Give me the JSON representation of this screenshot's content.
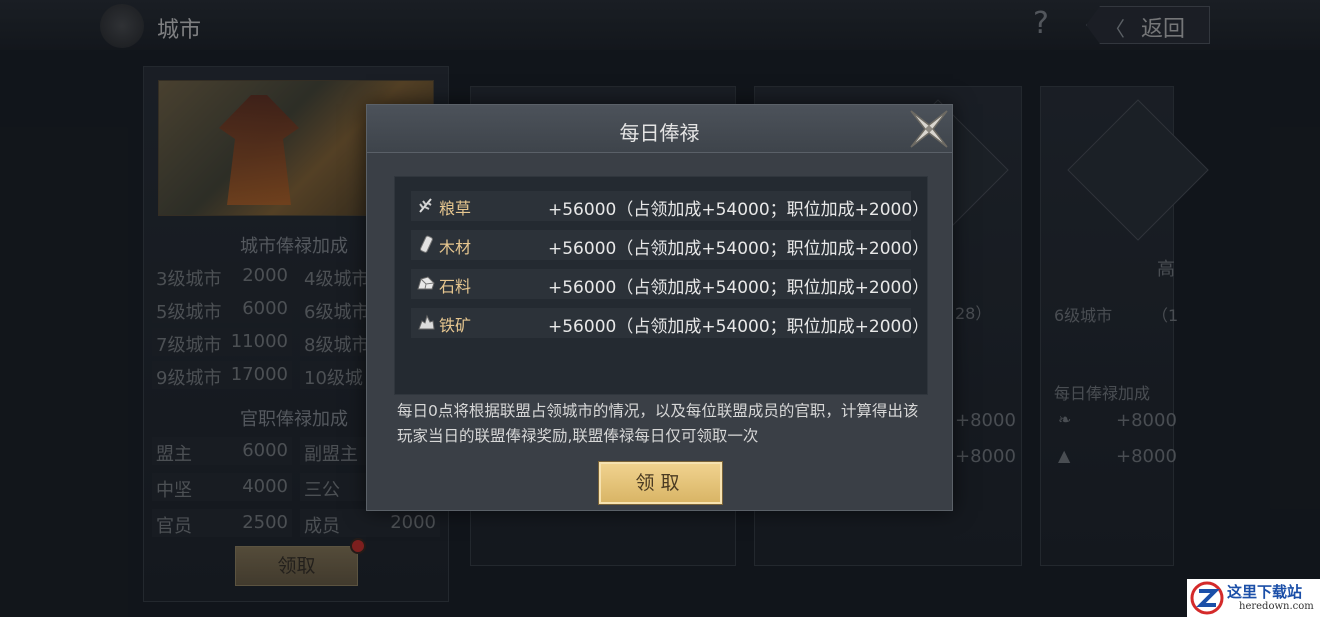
{
  "topbar": {
    "title": "城市",
    "help_label": "?",
    "back_label": "返回"
  },
  "bg_panel": {
    "salary_heading": "城市俸禄加成",
    "city_levels": [
      {
        "label": "3级城市",
        "value": "2000"
      },
      {
        "label": "4级城市",
        "value": ""
      },
      {
        "label": "5级城市",
        "value": "6000"
      },
      {
        "label": "6级城市",
        "value": ""
      },
      {
        "label": "7级城市",
        "value": "11000"
      },
      {
        "label": "8级城市",
        "value": ""
      },
      {
        "label": "9级城市",
        "value": "17000"
      },
      {
        "label": "10级城",
        "value": ""
      }
    ],
    "official_heading": "官职俸禄加成",
    "officials": [
      {
        "label": "盟主",
        "value": "6000"
      },
      {
        "label": "副盟主",
        "value": ""
      },
      {
        "label": "中坚",
        "value": "4000"
      },
      {
        "label": "三公",
        "value": ""
      },
      {
        "label": "官员",
        "value": "2500"
      },
      {
        "label": "成员",
        "value": "2000"
      }
    ],
    "claim_label": "领取"
  },
  "bg_right": {
    "p3_partial": "28）",
    "p3_plus1": "+8000",
    "p3_plus2": "+8000",
    "p4_title": "高",
    "p4_level": "6级城市",
    "p4_paren": "（1",
    "p4_heading": "每日俸禄加成",
    "p4_plus1": "+8000",
    "p4_plus2": "+8000"
  },
  "modal": {
    "title": "每日俸禄",
    "rows": [
      {
        "icon": "grain-icon",
        "label": "粮草",
        "value": "+56000（占领加成+54000；职位加成+2000）"
      },
      {
        "icon": "wood-icon",
        "label": "木材",
        "value": "+56000（占领加成+54000；职位加成+2000）"
      },
      {
        "icon": "stone-icon",
        "label": "石料",
        "value": "+56000（占领加成+54000；职位加成+2000）"
      },
      {
        "icon": "iron-icon",
        "label": "铁矿",
        "value": "+56000（占领加成+54000；职位加成+2000）"
      }
    ],
    "description": "每日0点将根据联盟占领城市的情况，以及每位联盟成员的官职，计算得出该玩家当日的联盟俸禄奖励,联盟俸禄每日仅可领取一次",
    "claim_label": "领取"
  },
  "watermark": {
    "cn": "这里下载站",
    "en": "heredown.com"
  },
  "colors": {
    "resource_label": "#e6c68f",
    "claim_button": "#e5c47c"
  }
}
